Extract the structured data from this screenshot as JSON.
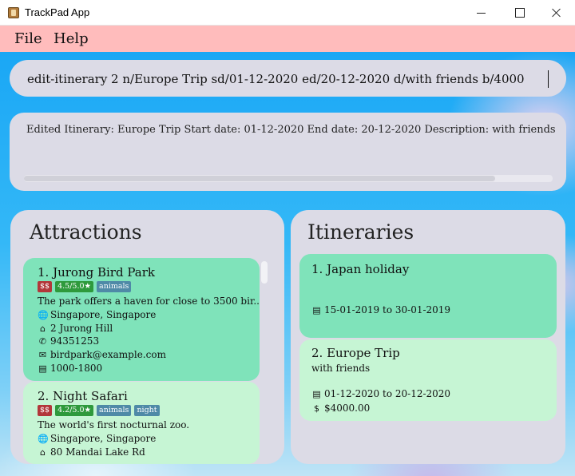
{
  "window": {
    "title": "TrackPad App"
  },
  "menu": {
    "file_label": "File",
    "help_label": "Help"
  },
  "command": {
    "value": "edit-itinerary 2 n/Europe Trip sd/01-12-2020 ed/20-12-2020 d/with friends b/4000"
  },
  "result": {
    "text": "Edited Itinerary: Europe Trip Start date: 01-12-2020 End date: 20-12-2020 Description: with friends Bud"
  },
  "attractions": {
    "title": "Attractions",
    "items": [
      {
        "name": "1.  Jurong Bird Park",
        "price": "$$",
        "rating": "4.5/5.0★",
        "tags": [
          "animals"
        ],
        "description": "The park offers a haven for close to 3500 bir...",
        "location": "Singapore, Singapore",
        "address": "2 Jurong Hill",
        "phone": "94351253",
        "email": "birdpark@example.com",
        "hours": "1000-1800"
      },
      {
        "name": "2.  Night Safari",
        "price": "$$",
        "rating": "4.2/5.0★",
        "tags": [
          "animals",
          "night"
        ],
        "description": "The world's first nocturnal zoo.",
        "location": "Singapore, Singapore",
        "address": "80 Mandai Lake Rd"
      }
    ]
  },
  "itineraries": {
    "title": "Itineraries",
    "items": [
      {
        "name": "1.  Japan holiday",
        "dates": "15-01-2019 to 30-01-2019"
      },
      {
        "name": "2.  Europe Trip",
        "description": "with friends",
        "dates": "01-12-2020 to 20-12-2020",
        "budget": "$4000.00"
      }
    ]
  },
  "icons": {
    "location": "globe-icon",
    "address": "home-icon",
    "phone": "phone-icon",
    "email": "envelope-icon",
    "hours": "calendar-icon",
    "budget": "dollar-icon"
  },
  "colors": {
    "menubar": "#ffbcbc",
    "panel": "#dcdbe6",
    "card_selected": "#7fe3ba",
    "card_default": "#c6f5d4",
    "tag_price": "#b2373a",
    "tag_rating": "#2e9a3c",
    "tag_plain": "#4f8aa7"
  }
}
